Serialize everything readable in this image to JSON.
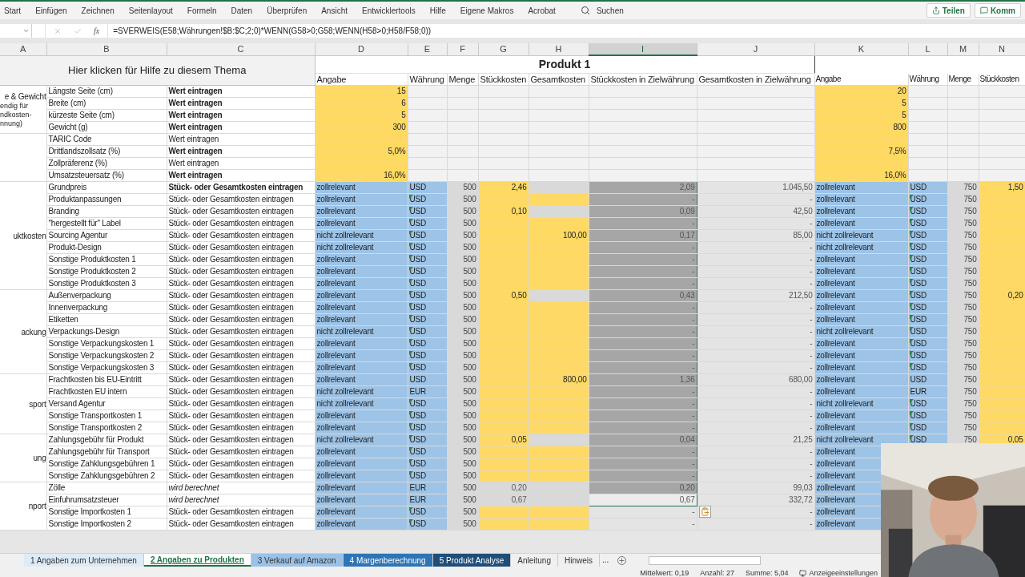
{
  "ribbon": {
    "tabs": [
      "Start",
      "Einfügen",
      "Zeichnen",
      "Seitenlayout",
      "Formeln",
      "Daten",
      "Überprüfen",
      "Ansicht",
      "Entwicklertools",
      "Hilfe",
      "Eigene Makros",
      "Acrobat"
    ],
    "search": "Suchen",
    "buttons": [
      {
        "label": "Teilen",
        "kind": "share"
      },
      {
        "label": "Komm",
        "kind": "comment"
      }
    ]
  },
  "formula_bar": {
    "fx": "fx",
    "formula": "=SVERWEIS(E58;Währungen!$B:$C;2;0)*WENN(G58>0;G58;WENN(H58>0;H58/F58;0))"
  },
  "columns": [
    {
      "label": "A",
      "selected": false
    },
    {
      "label": "B",
      "selected": false
    },
    {
      "label": "C",
      "selected": false
    },
    {
      "label": "D",
      "selected": false
    },
    {
      "label": "E",
      "selected": false
    },
    {
      "label": "F",
      "selected": false
    },
    {
      "label": "G",
      "selected": false
    },
    {
      "label": "H",
      "selected": false
    },
    {
      "label": "I",
      "selected": true
    },
    {
      "label": "J",
      "selected": false
    },
    {
      "label": "K",
      "selected": false
    },
    {
      "label": "L",
      "selected": false
    },
    {
      "label": "M",
      "selected": false
    },
    {
      "label": "N",
      "selected": false
    }
  ],
  "help_link": "Hier klicken für Hilfe zu diesem Thema",
  "product": {
    "title": "Produkt 1",
    "columns": [
      "Angabe",
      "Währung",
      "Menge",
      "Stückkosten",
      "Gesamtkosten",
      "Stückkosten in Zielwährung",
      "Gesamtkosten in Zielwährung"
    ]
  },
  "product2_columns": [
    "Angabe",
    "Währung",
    "Menge",
    "Stückkosten"
  ],
  "groups": [
    {
      "title": "e & Gewicht",
      "note": [
        "endig für",
        "ndkosten-",
        "nnung)"
      ],
      "rows": [
        {
          "kind": "dimension",
          "b": "Längste Seite (cm)",
          "c": "Wert eintragen",
          "c_bold": true,
          "c_italic": false,
          "d": "15",
          "k": "20"
        },
        {
          "kind": "dimension",
          "b": "Breite (cm)",
          "c": "Wert eintragen",
          "c_bold": true,
          "c_italic": false,
          "d": "6",
          "k": "5"
        },
        {
          "kind": "dimension",
          "b": "kürzeste Seite (cm)",
          "c": "Wert eintragen",
          "c_bold": true,
          "c_italic": false,
          "d": "5",
          "k": "5"
        },
        {
          "kind": "dimension",
          "b": "Gewicht (g)",
          "c": "Wert eintragen",
          "c_bold": true,
          "c_italic": false,
          "d": "300",
          "k": "800"
        }
      ]
    },
    {
      "rows": [
        {
          "kind": "dimension",
          "b": "TARIC Code",
          "c": "Wert eintragen",
          "c_bold": false,
          "c_italic": false
        },
        {
          "kind": "dimension",
          "b": "Drittlandszollsatz (%)",
          "c": "Wert eintragen",
          "c_bold": true,
          "c_italic": false,
          "d": "5,0%",
          "k": "7,5%"
        },
        {
          "kind": "dimension",
          "b": "Zollpräferenz (%)",
          "c": "Wert eintragen",
          "c_bold": false,
          "c_italic": false
        },
        {
          "kind": "dimension",
          "b": "Umsatzsteuersatz (%)",
          "c": "Wert eintragen",
          "c_bold": true,
          "c_italic": false,
          "d": "16,0%",
          "k": "16,0%"
        }
      ]
    },
    {
      "title": "uktkosten",
      "rows": [
        {
          "kind": "cost",
          "g_input": true,
          "h_input": false,
          "b": "Grundpreis",
          "c": "Stück- oder Gesamtkosten eintragen",
          "c_bold": true,
          "c_italic": false,
          "d": "zollrelevant",
          "e": "USD",
          "e_flag": false,
          "f": "500",
          "g": "2,46",
          "i": "2,09",
          "j": "1.045,50",
          "k": "zollrelevant",
          "l": "USD",
          "m": "750",
          "n": "1,50",
          "i_selected": true,
          "i_active": false
        },
        {
          "kind": "cost",
          "g_input": true,
          "h_input": true,
          "b": "Produktanpassungen",
          "c": "Stück- oder Gesamtkosten eintragen",
          "c_bold": false,
          "c_italic": false,
          "d": "zollrelevant",
          "e": "USD",
          "e_flag": true,
          "f": "500",
          "i": "-",
          "j": "-",
          "k": "zollrelevant",
          "l": "USD",
          "m": "750",
          "i_selected": true,
          "i_active": false
        },
        {
          "kind": "cost",
          "g_input": true,
          "h_input": false,
          "b": "Branding",
          "c": "Stück- oder Gesamtkosten eintragen",
          "c_bold": false,
          "c_italic": false,
          "d": "zollrelevant",
          "e": "USD",
          "e_flag": true,
          "f": "500",
          "g": "0,10",
          "i": "0,09",
          "j": "42,50",
          "k": "zollrelevant",
          "l": "USD",
          "m": "750",
          "i_selected": true,
          "i_active": false
        },
        {
          "kind": "cost",
          "g_input": true,
          "h_input": true,
          "b": "\"hergestellt für\" Label",
          "c": "Stück- oder Gesamtkosten eintragen",
          "c_bold": false,
          "c_italic": false,
          "d": "zollrelevant",
          "e": "USD",
          "e_flag": true,
          "f": "500",
          "i": "-",
          "j": "-",
          "k": "zollrelevant",
          "l": "USD",
          "m": "750",
          "i_selected": true,
          "i_active": false
        },
        {
          "kind": "cost",
          "g_input": true,
          "h_input": true,
          "b": "Sourcing Agentur",
          "c": "Stück- oder Gesamtkosten eintragen",
          "c_bold": false,
          "c_italic": false,
          "d": "nicht zollrelevant",
          "e": "USD",
          "e_flag": true,
          "f": "500",
          "h": "100,00",
          "i": "0,17",
          "j": "85,00",
          "k": "nicht zollrelevant",
          "l": "USD",
          "m": "750",
          "i_selected": true,
          "i_active": false
        },
        {
          "kind": "cost",
          "g_input": true,
          "h_input": true,
          "b": "Produkt-Design",
          "c": "Stück- oder Gesamtkosten eintragen",
          "c_bold": false,
          "c_italic": false,
          "d": "nicht zollrelevant",
          "e": "USD",
          "e_flag": true,
          "f": "500",
          "i": "-",
          "j": "-",
          "k": "nicht zollrelevant",
          "l": "USD",
          "m": "750",
          "i_selected": true,
          "i_active": false
        },
        {
          "kind": "cost",
          "g_input": true,
          "h_input": true,
          "b": "Sonstige Produktkosten 1",
          "c": "Stück- oder Gesamtkosten eintragen",
          "c_bold": false,
          "c_italic": false,
          "d": "zollrelevant",
          "e": "USD",
          "e_flag": true,
          "f": "500",
          "i": "-",
          "j": "-",
          "k": "zollrelevant",
          "l": "USD",
          "m": "750",
          "i_selected": true,
          "i_active": false
        },
        {
          "kind": "cost",
          "g_input": true,
          "h_input": true,
          "b": "Sonstige Produktkosten 2",
          "c": "Stück- oder Gesamtkosten eintragen",
          "c_bold": false,
          "c_italic": false,
          "d": "zollrelevant",
          "e": "USD",
          "e_flag": true,
          "f": "500",
          "i": "-",
          "j": "-",
          "k": "zollrelevant",
          "l": "USD",
          "m": "750",
          "i_selected": true,
          "i_active": false
        },
        {
          "kind": "cost",
          "g_input": true,
          "h_input": true,
          "b": "Sonstige Produktkosten 3",
          "c": "Stück- oder Gesamtkosten eintragen",
          "c_bold": false,
          "c_italic": false,
          "d": "zollrelevant",
          "e": "USD",
          "e_flag": true,
          "f": "500",
          "i": "-",
          "j": "-",
          "k": "zollrelevant",
          "l": "USD",
          "m": "750",
          "i_selected": true,
          "i_active": false
        }
      ]
    },
    {
      "title": "ackung",
      "rows": [
        {
          "kind": "cost",
          "g_input": true,
          "h_input": false,
          "b": "Außenverpackung",
          "c": "Stück- oder Gesamtkosten eintragen",
          "c_bold": false,
          "c_italic": false,
          "d": "zollrelevant",
          "e": "USD",
          "e_flag": true,
          "f": "500",
          "g": "0,50",
          "i": "0,43",
          "j": "212,50",
          "k": "zollrelevant",
          "l": "USD",
          "m": "750",
          "n": "0,20",
          "i_selected": true,
          "i_active": false
        },
        {
          "kind": "cost",
          "g_input": true,
          "h_input": true,
          "b": "Innenverpackung",
          "c": "Stück- oder Gesamtkosten eintragen",
          "c_bold": false,
          "c_italic": false,
          "d": "zollrelevant",
          "e": "USD",
          "e_flag": true,
          "f": "500",
          "i": "-",
          "j": "-",
          "k": "zollrelevant",
          "l": "USD",
          "m": "750",
          "i_selected": true,
          "i_active": false
        },
        {
          "kind": "cost",
          "g_input": true,
          "h_input": true,
          "b": "Etiketten",
          "c": "Stück- oder Gesamtkosten eintragen",
          "c_bold": false,
          "c_italic": false,
          "d": "zollrelevant",
          "e": "USD",
          "e_flag": true,
          "f": "500",
          "i": "-",
          "j": "-",
          "k": "zollrelevant",
          "l": "USD",
          "m": "750",
          "i_selected": true,
          "i_active": false
        },
        {
          "kind": "cost",
          "g_input": true,
          "h_input": true,
          "b": "Verpackungs-Design",
          "c": "Stück- oder Gesamtkosten eintragen",
          "c_bold": false,
          "c_italic": false,
          "d": "nicht zollrelevant",
          "e": "USD",
          "e_flag": true,
          "f": "500",
          "i": "-",
          "j": "-",
          "k": "nicht zollrelevant",
          "l": "USD",
          "m": "750",
          "i_selected": true,
          "i_active": false
        },
        {
          "kind": "cost",
          "g_input": true,
          "h_input": true,
          "b": "Sonstige Verpackungskosten 1",
          "c": "Stück- oder Gesamtkosten eintragen",
          "c_bold": false,
          "c_italic": false,
          "d": "zollrelevant",
          "e": "USD",
          "e_flag": true,
          "f": "500",
          "i": "-",
          "j": "-",
          "k": "zollrelevant",
          "l": "USD",
          "m": "750",
          "i_selected": true,
          "i_active": false
        },
        {
          "kind": "cost",
          "g_input": true,
          "h_input": true,
          "b": "Sonstige Verpackungskosten 2",
          "c": "Stück- oder Gesamtkosten eintragen",
          "c_bold": false,
          "c_italic": false,
          "d": "zollrelevant",
          "e": "USD",
          "e_flag": true,
          "f": "500",
          "i": "-",
          "j": "-",
          "k": "zollrelevant",
          "l": "USD",
          "m": "750",
          "i_selected": true,
          "i_active": false
        },
        {
          "kind": "cost",
          "g_input": true,
          "h_input": true,
          "b": "Sonstige Verpackungskosten 3",
          "c": "Stück- oder Gesamtkosten eintragen",
          "c_bold": false,
          "c_italic": false,
          "d": "zollrelevant",
          "e": "USD",
          "e_flag": true,
          "f": "500",
          "i": "-",
          "j": "-",
          "k": "zollrelevant",
          "l": "USD",
          "m": "750",
          "i_selected": true,
          "i_active": false
        }
      ]
    },
    {
      "title": "sport",
      "rows": [
        {
          "kind": "cost",
          "g_input": true,
          "h_input": true,
          "b": "Frachtkosten bis EU-Eintritt",
          "c": "Stück- oder Gesamtkosten eintragen",
          "c_bold": false,
          "c_italic": false,
          "d": "zollrelevant",
          "e": "USD",
          "e_flag": false,
          "f": "500",
          "h": "800,00",
          "i": "1,36",
          "j": "680,00",
          "k": "zollrelevant",
          "l": "USD",
          "m": "750",
          "i_selected": true,
          "i_active": false
        },
        {
          "kind": "cost",
          "g_input": true,
          "h_input": true,
          "b": "Frachtkosten EU intern",
          "c": "Stück- oder Gesamtkosten eintragen",
          "c_bold": false,
          "c_italic": false,
          "d": "nicht zollrelevant",
          "e": "EUR",
          "e_flag": false,
          "f": "500",
          "i": "-",
          "j": "-",
          "k": "zollrelevant",
          "l": "EUR",
          "m": "750",
          "i_selected": true,
          "i_active": false
        },
        {
          "kind": "cost",
          "g_input": true,
          "h_input": true,
          "b": "Versand Agentur",
          "c": "Stück- oder Gesamtkosten eintragen",
          "c_bold": false,
          "c_italic": false,
          "d": "nicht zollrelevant",
          "e": "USD",
          "e_flag": true,
          "f": "500",
          "i": "-",
          "j": "-",
          "k": "nicht zollrelevant",
          "l": "USD",
          "m": "750",
          "i_selected": true,
          "i_active": false
        },
        {
          "kind": "cost",
          "g_input": true,
          "h_input": true,
          "b": "Sonstige Transportkosten 1",
          "c": "Stück- oder Gesamtkosten eintragen",
          "c_bold": false,
          "c_italic": false,
          "d": "zollrelevant",
          "e": "USD",
          "e_flag": true,
          "f": "500",
          "i": "-",
          "j": "-",
          "k": "zollrelevant",
          "l": "USD",
          "m": "750",
          "i_selected": true,
          "i_active": false
        },
        {
          "kind": "cost",
          "g_input": true,
          "h_input": true,
          "b": "Sonstige Transportkosten 2",
          "c": "Stück- oder Gesamtkosten eintragen",
          "c_bold": false,
          "c_italic": false,
          "d": "zollrelevant",
          "e": "USD",
          "e_flag": true,
          "f": "500",
          "i": "-",
          "j": "-",
          "k": "zollrelevant",
          "l": "USD",
          "m": "750",
          "i_selected": true,
          "i_active": false
        }
      ]
    },
    {
      "title": "ung",
      "rows": [
        {
          "kind": "cost",
          "g_input": true,
          "h_input": false,
          "b": "Zahlungsgebühr für Produkt",
          "c": "Stück- oder Gesamtkosten eintragen",
          "c_bold": false,
          "c_italic": false,
          "d": "nicht zollrelevant",
          "e": "USD",
          "e_flag": true,
          "f": "500",
          "g": "0,05",
          "i": "0,04",
          "j": "21,25",
          "k": "nicht zollrelevant",
          "l": "USD",
          "m": "750",
          "n": "0,05",
          "i_selected": true,
          "i_active": false
        },
        {
          "kind": "cost",
          "g_input": true,
          "h_input": true,
          "b": "Zahlungsgebühr für Transport",
          "c": "Stück- oder Gesamtkosten eintragen",
          "c_bold": false,
          "c_italic": false,
          "d": "zollrelevant",
          "e": "USD",
          "e_flag": true,
          "f": "500",
          "i": "-",
          "j": "-",
          "k": "zollrelevant",
          "i_selected": true,
          "i_active": false
        },
        {
          "kind": "cost",
          "g_input": true,
          "h_input": true,
          "b": "Sonstige Zahklungsgebühren 1",
          "c": "Stück- oder Gesamtkosten eintragen",
          "c_bold": false,
          "c_italic": false,
          "d": "zollrelevant",
          "e": "USD",
          "e_flag": true,
          "f": "500",
          "i": "-",
          "j": "-",
          "k": "zollrelevant",
          "i_selected": true,
          "i_active": false
        },
        {
          "kind": "cost",
          "g_input": true,
          "h_input": true,
          "b": "Sonstige Zahklungsgebühren 2",
          "c": "Stück- oder Gesamtkosten eintragen",
          "c_bold": false,
          "c_italic": false,
          "d": "zollrelevant",
          "e": "USD",
          "e_flag": true,
          "f": "500",
          "i": "-",
          "j": "-",
          "k": "zollrelevant",
          "i_selected": true,
          "i_active": false
        }
      ]
    },
    {
      "title": "nport",
      "rows": [
        {
          "kind": "cost",
          "g_input": false,
          "h_input": false,
          "b": "Zölle",
          "c": "wird berechnet",
          "c_bold": false,
          "c_italic": true,
          "d": "zollrelevant",
          "e": "EUR",
          "e_flag": false,
          "f": "500",
          "g": "0,20",
          "i": "0,20",
          "j": "99,03",
          "k": "zollrelevant",
          "i_selected": true,
          "i_active": false
        },
        {
          "kind": "cost",
          "g_input": false,
          "h_input": false,
          "b": "Einfuhrumsatzsteuer",
          "c": "wird berechnet",
          "c_bold": false,
          "c_italic": true,
          "d": "zollrelevant",
          "e": "EUR",
          "e_flag": false,
          "f": "500",
          "g": "0,67",
          "i": "0,67",
          "j": "332,72",
          "k": "zollrelevant",
          "i_selected": true,
          "i_active": true
        },
        {
          "kind": "cost",
          "g_input": true,
          "h_input": true,
          "b": "Sonstige Importkosten 1",
          "c": "Stück- oder Gesamtkosten eintragen",
          "c_bold": false,
          "c_italic": false,
          "d": "zollrelevant",
          "e": "USD",
          "e_flag": true,
          "f": "500",
          "i": "-",
          "j": "-",
          "k": "zollrelevant",
          "i_selected": false,
          "i_active": false
        },
        {
          "kind": "cost",
          "g_input": true,
          "h_input": true,
          "b": "Sonstige Importkosten 2",
          "c": "Stück- oder Gesamtkosten eintragen",
          "c_bold": false,
          "c_italic": false,
          "d": "zollrelevant",
          "e": "USD",
          "e_flag": true,
          "f": "500",
          "i": "-",
          "j": "-",
          "k": "zollrelevant",
          "i_selected": false,
          "i_active": false
        }
      ]
    }
  ],
  "sheet_tabs": [
    {
      "label": "1 Angaben zum Unternehmen",
      "color": "#ddebf7",
      "selected": false
    },
    {
      "label": "2 Angaben zu Produkten",
      "color": "#ffffff",
      "selected": true
    },
    {
      "label": "3 Verkauf auf Amazon",
      "color": "#9bc2e6",
      "selected": false
    },
    {
      "label": "4 Margenberechnung",
      "color": "#2e75b6",
      "selected": false
    },
    {
      "label": "5 Produkt Analyse",
      "color": "#1f4e79",
      "selected": false
    },
    {
      "label": "Anleitung",
      "color": "#f0f0f0",
      "selected": false
    },
    {
      "label": "Hinweis",
      "color": "#f0f0f0",
      "selected": false
    }
  ],
  "more_tabs": "...",
  "status_bar": {
    "items": [
      "Mittelwert: 0,19",
      "Anzahl: 27",
      "Summe: 5,04"
    ],
    "display_settings": "Anzeigeeinstellungen"
  },
  "webcam": {
    "kind": "picture"
  }
}
